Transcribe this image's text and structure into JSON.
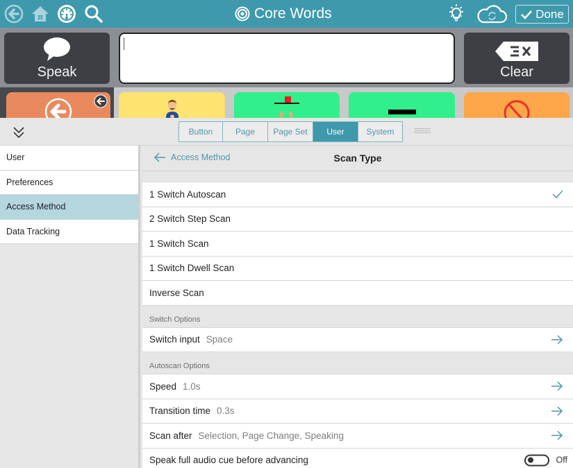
{
  "topbar": {
    "title": "Core Words",
    "done_label": "Done",
    "icons": [
      "back-icon",
      "home-icon",
      "dashboard-icon",
      "search-icon",
      "lightbulb-icon",
      "cloud-sync-icon"
    ]
  },
  "message_bar": {
    "speak_label": "Speak",
    "clear_label": "Clear",
    "input_value": ""
  },
  "tiles": [
    {
      "name": "back-tile",
      "color": "#e98a5e",
      "icon": "back-arrow-icon"
    },
    {
      "name": "person-signing-tile",
      "color": "#fde36f",
      "icon": "person-icon"
    },
    {
      "name": "above-tile",
      "color": "#31ef8a",
      "icon": "above-symbol-icon"
    },
    {
      "name": "minus-tile",
      "color": "#31ef8a",
      "icon": "minus-icon"
    },
    {
      "name": "no-tile",
      "color": "#fda64a",
      "icon": "prohibited-icon"
    }
  ],
  "settings_tabs": {
    "items": [
      "Button",
      "Page",
      "Page Set",
      "User",
      "System"
    ],
    "active": "User"
  },
  "sidebar": {
    "items": [
      {
        "label": "User",
        "active": false
      },
      {
        "label": "Preferences",
        "active": false
      },
      {
        "label": "Access Method",
        "active": true
      },
      {
        "label": "Data Tracking",
        "active": false
      }
    ]
  },
  "panel": {
    "back_label": "Access Method",
    "title": "Scan Type",
    "scan_types": [
      {
        "label": "1 Switch Autoscan",
        "selected": true
      },
      {
        "label": "2 Switch Step Scan",
        "selected": false
      },
      {
        "label": "1 Switch Scan",
        "selected": false
      },
      {
        "label": "1 Switch Dwell Scan",
        "selected": false
      },
      {
        "label": "Inverse Scan",
        "selected": false
      }
    ],
    "switch_options": {
      "header": "Switch Options",
      "switch_input": {
        "label": "Switch input",
        "value": "Space"
      }
    },
    "autoscan_options": {
      "header": "Autoscan Options",
      "speed": {
        "label": "Speed",
        "value": "1.0s"
      },
      "transition_time": {
        "label": "Transition time",
        "value": "0.3s"
      },
      "scan_after": {
        "label": "Scan after",
        "value": "Selection, Page Change, Speaking"
      },
      "speak_full_cue": {
        "label": "Speak full audio cue before advancing",
        "state": "Off"
      }
    }
  },
  "colors": {
    "accent": "#3f99ac",
    "sidebar_active": "#b3d6df",
    "dark_button": "#3d3f44"
  }
}
